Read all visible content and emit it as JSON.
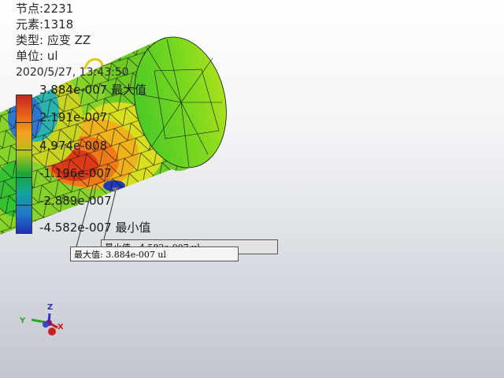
{
  "info": {
    "nodes": "节点:2231",
    "elements": "元素:1318",
    "type": "类型: 应变 ZZ",
    "unit": "单位: ul",
    "datetime": "2020/5/27, 13:43:50"
  },
  "legend": {
    "max_label": "3.884e-007 最大值",
    "labels": [
      "2.191e-007",
      "4.974e-008",
      "-1.196e-007",
      "-2.889e-007"
    ],
    "min_label": "-4.582e-007 最小值",
    "colors": [
      "#c0281e",
      "#e85f1a",
      "#f2a31c",
      "#a9c521",
      "#1aa536",
      "#15a3a0",
      "#1f78c8",
      "#1f31b5"
    ]
  },
  "callouts": {
    "min_text": "最小值: -4.582e-007 ul",
    "max_text": "最大值: 3.884e-007 ul"
  },
  "axes": {
    "x": "X",
    "y": "Y",
    "z": "Z"
  }
}
